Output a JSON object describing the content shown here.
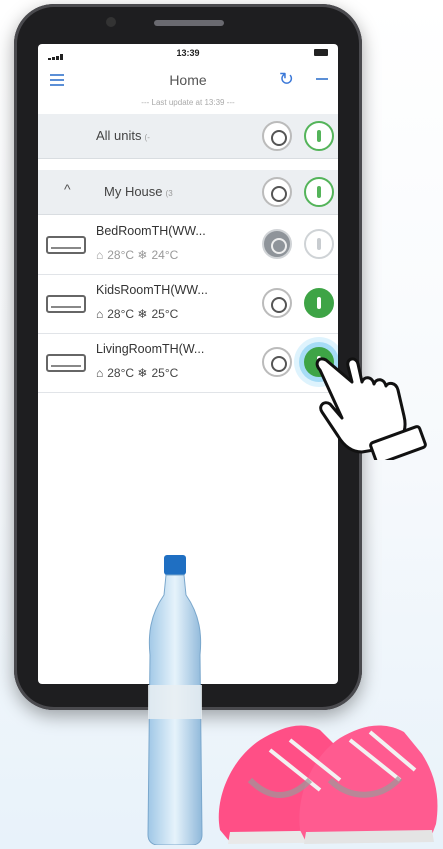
{
  "status_bar": {
    "time": "13:39"
  },
  "navbar": {
    "title": "Home",
    "refresh_icon": "refresh-icon",
    "menu_icon": "menu-icon"
  },
  "last_update": "--- Last update at 13:39 ---",
  "groups": [
    {
      "label": "All units",
      "sub": "(-",
      "off_state": "outline",
      "on_state": "outline"
    },
    {
      "label": "My House",
      "sub": "(3",
      "off_state": "outline",
      "on_state": "outline"
    }
  ],
  "units": [
    {
      "name": "BedRoomTH(WW...",
      "room_temp": "28°C",
      "set_temp": "24°C",
      "power": "off"
    },
    {
      "name": "KidsRoomTH(WW...",
      "room_temp": "28°C",
      "set_temp": "25°C",
      "power": "on"
    },
    {
      "name": "LivingRoomTH(W...",
      "room_temp": "28°C",
      "set_temp": "25°C",
      "power": "on"
    }
  ],
  "colors": {
    "on_green": "#3ea446",
    "accent_blue": "#3b78d8",
    "header_gray": "#eceff2"
  }
}
